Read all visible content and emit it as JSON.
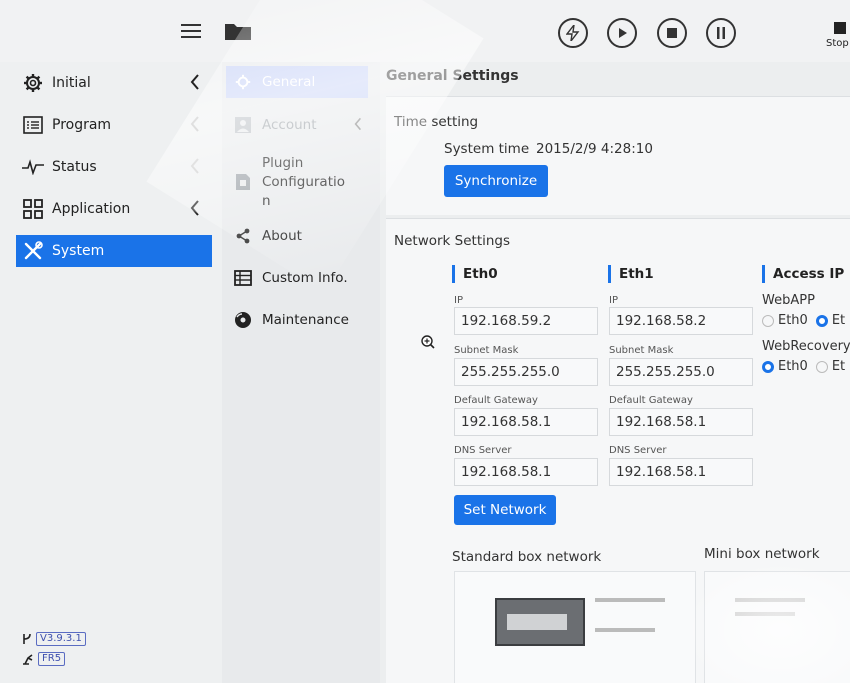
{
  "topbar": {
    "stop_label": "Stop"
  },
  "leftnav": {
    "items": [
      {
        "label": "Initial",
        "icon": "gear-icon"
      },
      {
        "label": "Program",
        "icon": "list-icon"
      },
      {
        "label": "Status",
        "icon": "pulse-icon"
      },
      {
        "label": "Application",
        "icon": "grid-icon"
      },
      {
        "label": "System",
        "icon": "tools-icon"
      }
    ],
    "version": "V3.9.3.1",
    "fw": "FR5"
  },
  "subnav": {
    "items": [
      {
        "label": "General",
        "icon": "gear-icon"
      },
      {
        "label": "Account",
        "icon": "person-icon"
      },
      {
        "label": "Plugin\nConfiguratio\nn",
        "icon": "plugin-icon"
      },
      {
        "label": "About",
        "icon": "share-icon"
      },
      {
        "label": "Custom Info.",
        "icon": "table-icon"
      },
      {
        "label": "Maintenance",
        "icon": "disc-icon"
      }
    ]
  },
  "main": {
    "title": "General Settings",
    "time": {
      "section": "Time setting",
      "label": "System time",
      "value": "2015/2/9 4:28:10",
      "sync_button": "Synchronize"
    },
    "network": {
      "section": "Network Settings",
      "eth0": {
        "head": "Eth0",
        "ip_label": "IP",
        "ip": "192.168.59.2",
        "mask_label": "Subnet Mask",
        "mask": "255.255.255.0",
        "gw_label": "Default Gateway",
        "gw": "192.168.58.1",
        "dns_label": "DNS Server",
        "dns": "192.168.58.1"
      },
      "eth1": {
        "head": "Eth1",
        "ip_label": "IP",
        "ip": "192.168.58.2",
        "mask_label": "Subnet Mask",
        "mask": "255.255.255.0",
        "gw_label": "Default Gateway",
        "gw": "192.168.58.1",
        "dns_label": "DNS Server",
        "dns": "192.168.58.1"
      },
      "access": {
        "head": "Access IP",
        "webapp_label": "WebAPP",
        "webrecovery_label": "WebRecovery",
        "opt_eth0": "Eth0",
        "opt_eth1": "Et"
      },
      "set_button": "Set Network",
      "standard_box": "Standard box network",
      "mini_box": "Mini box network"
    }
  },
  "colors": {
    "accent": "#1a73e8",
    "active_sub": "#c7d2f7"
  }
}
